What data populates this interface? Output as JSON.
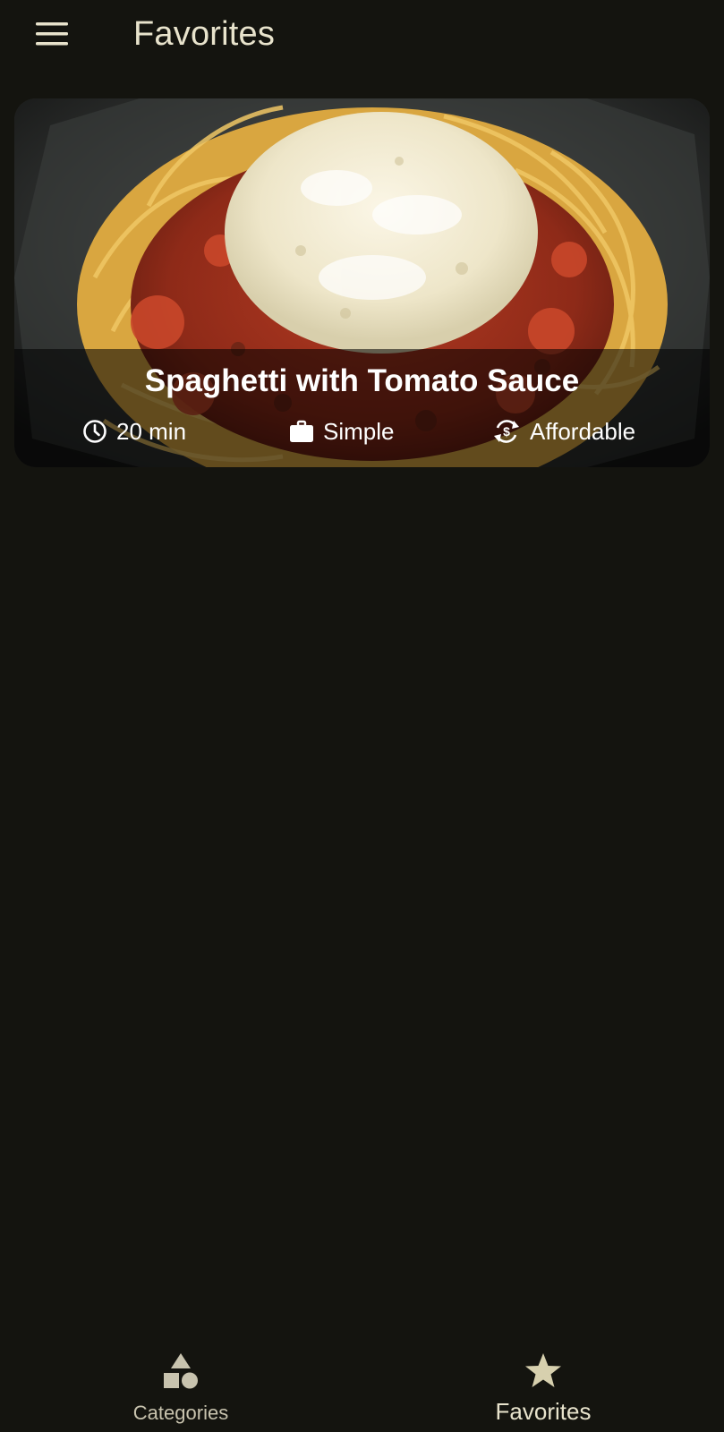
{
  "appbar": {
    "title": "Favorites",
    "menu_icon": "menu-icon"
  },
  "meal": {
    "title": "Spaghetti with Tomato Sauce",
    "duration": "20 min",
    "complexity": "Simple",
    "affordability": "Affordable",
    "duration_icon": "clock-icon",
    "complexity_icon": "briefcase-icon",
    "affordability_icon": "price-exchange-icon"
  },
  "bottom_nav": {
    "items": [
      {
        "label": "Categories",
        "icon": "category-shapes-icon",
        "selected": false
      },
      {
        "label": "Favorites",
        "icon": "star-icon",
        "selected": true
      }
    ]
  },
  "colors": {
    "background": "#14140f",
    "on_surface": "#e8e3cc",
    "nav_unselected": "#c8c3ae",
    "overlay": "#000000"
  }
}
